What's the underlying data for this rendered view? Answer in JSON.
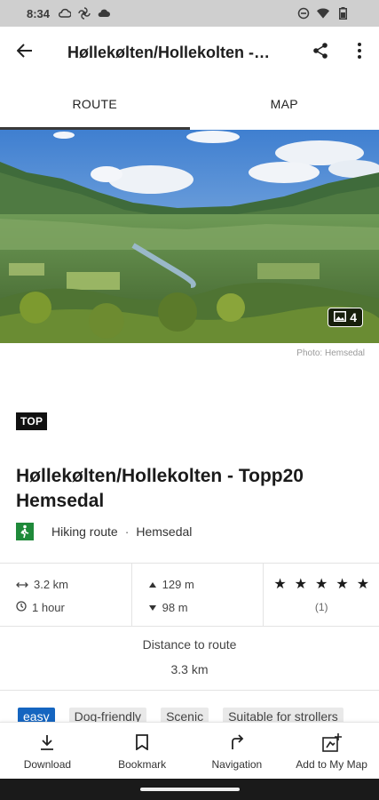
{
  "status_bar": {
    "time": "8:34",
    "left_icons": [
      "cloud-sync-icon",
      "fan-icon",
      "cloud-icon"
    ],
    "right_icons": [
      "do-not-disturb-icon",
      "wifi-icon",
      "battery-icon"
    ]
  },
  "app_bar": {
    "title": "Høllekølten/Hollekolten -…",
    "back_icon": "arrow-back-icon",
    "share_icon": "share-icon",
    "more_icon": "more-vert-icon"
  },
  "tabs": [
    {
      "label": "ROUTE",
      "active": true
    },
    {
      "label": "MAP",
      "active": false
    }
  ],
  "hero": {
    "photo_count": "4",
    "credit": "Photo: Hemsedal"
  },
  "badge": "TOP",
  "route": {
    "title": "Høllekølten/Hollekolten - Topp20 Hemsedal",
    "type": "Hiking route",
    "separator": "·",
    "region": "Hemsedal",
    "type_color": "#1f8a3a"
  },
  "stats": {
    "distance": "3.2 km",
    "duration": "1 hour",
    "ascent": "129 m",
    "descent": "98 m",
    "rating_stars": 5,
    "rating_count": "(1)"
  },
  "distance_to_route": {
    "label": "Distance to route",
    "value": "3.3 km"
  },
  "tags": [
    {
      "label": "easy",
      "kind": "difficulty"
    },
    {
      "label": "Dog-friendly",
      "kind": "tag"
    },
    {
      "label": "Scenic",
      "kind": "tag"
    },
    {
      "label": "Suitable for strollers",
      "kind": "tag"
    }
  ],
  "bottom_nav": {
    "download": "Download",
    "bookmark": "Bookmark",
    "navigation": "Navigation",
    "add_map": "Add to My Map"
  },
  "colors": {
    "difficulty_easy": "#1565c0",
    "badge_bg": "#111111"
  }
}
